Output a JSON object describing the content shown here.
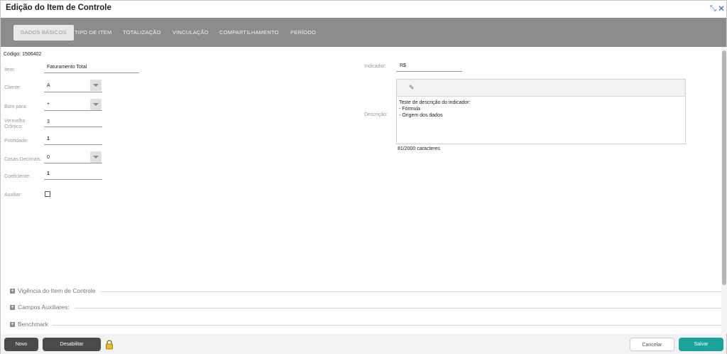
{
  "window": {
    "title": "Edição do Item de Controle",
    "expand_glyph": "⤡",
    "close_glyph": "✕"
  },
  "tabs": [
    {
      "label": "DADOS BÁSICOS",
      "active": true
    },
    {
      "label": "TIPO DE ITEM",
      "active": false
    },
    {
      "label": "TOTALIZAÇÃO",
      "active": false
    },
    {
      "label": "VINCULAÇÃO",
      "active": false
    },
    {
      "label": "COMPARTILHAMENTO",
      "active": false
    },
    {
      "label": "PERÍODO",
      "active": false
    }
  ],
  "form": {
    "codigo": "Código: 1506402",
    "item_label": "Item:",
    "item_value": "Faturamento Total",
    "cliente_label": "Cliente:",
    "cliente_value": "A",
    "bom_para_label": "Bom para:",
    "bom_para_value": "+",
    "vermelho_label": "Vermelho Crônico:",
    "vermelho_value": "3",
    "prioridade_label": "Prioridade:",
    "prioridade_value": "1",
    "casas_label": "Casas Decimais:",
    "casas_value": "0",
    "coeficiente_label": "Coeficiente:",
    "coeficiente_value": "1",
    "auxiliar_label": "Auxiliar:",
    "indicador_label": "Indicador:",
    "indicador_value": "R$",
    "descricao_label": "Descrição:",
    "descricao_text": "Teste de descrição do indicador:\n- Fórmula\n- Origem dos dados",
    "char_count": "81/2000 caracteres",
    "editor_tool_glyph": "✎"
  },
  "sections": [
    {
      "title": "Vigência do Item de Controle"
    },
    {
      "title": "Campos Auxiliares:"
    },
    {
      "title": "Benchmark"
    }
  ],
  "footer": {
    "novo": "Novo",
    "desabilitar": "Desabilitar",
    "cancelar": "Cancelar",
    "salvar": "Salvar"
  },
  "colors": {
    "tabbar": "#8c8c8c",
    "primary": "#1aa39a",
    "dark_button": "#4a4a4a",
    "lock": "#e8c21c"
  }
}
